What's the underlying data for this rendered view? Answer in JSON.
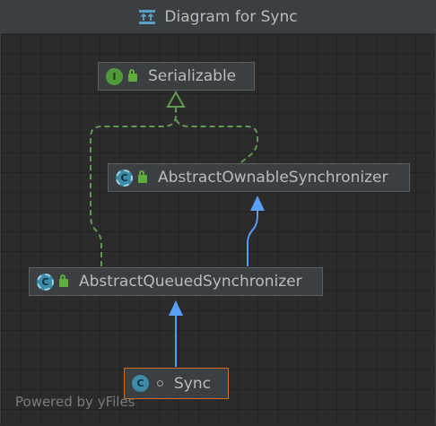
{
  "window": {
    "title": "Diagram for Sync"
  },
  "diagram": {
    "nodes": [
      {
        "id": "serializable",
        "label": "Serializable",
        "kind": "interface",
        "badge": "I",
        "modifier": "lock-icon"
      },
      {
        "id": "aos",
        "label": "AbstractOwnableSynchronizer",
        "kind": "abstract-class",
        "badge": "C",
        "modifier": "lock-icon"
      },
      {
        "id": "aqs",
        "label": "AbstractQueuedSynchronizer",
        "kind": "abstract-class",
        "badge": "C",
        "modifier": "lock-icon"
      },
      {
        "id": "sync",
        "label": "Sync",
        "kind": "class",
        "badge": "C",
        "modifier": "package-private-icon",
        "selected": true
      }
    ],
    "edges": [
      {
        "from": "aqs",
        "to": "serializable",
        "type": "implements",
        "style": "dashed",
        "color": "#629755"
      },
      {
        "from": "aos",
        "to": "serializable",
        "type": "implements",
        "style": "dashed",
        "color": "#629755"
      },
      {
        "from": "aqs",
        "to": "aos",
        "type": "extends",
        "style": "solid",
        "color": "#589df6"
      },
      {
        "from": "sync",
        "to": "aqs",
        "type": "extends",
        "style": "solid",
        "color": "#589df6"
      }
    ]
  },
  "footer": {
    "powered_by": "Powered by yFiles"
  },
  "colors": {
    "background": "#2b2b2b",
    "node_fill": "#3c3f41",
    "selection_border": "#c96d20",
    "implements_edge": "#629755",
    "extends_edge": "#589df6"
  }
}
